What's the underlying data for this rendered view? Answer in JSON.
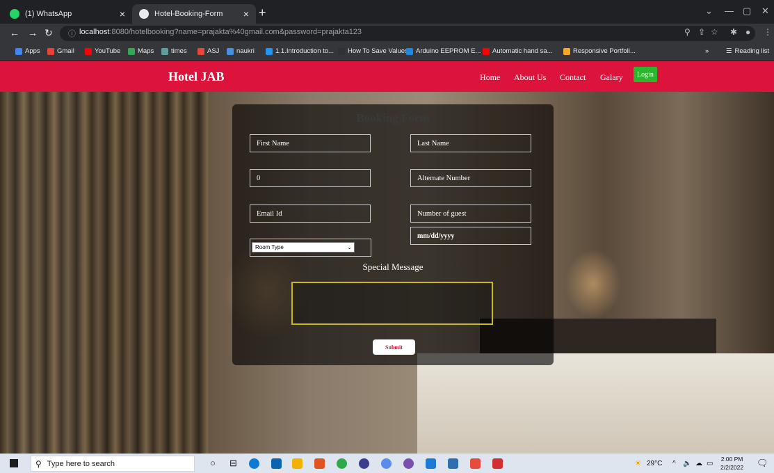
{
  "browser": {
    "tabs": [
      {
        "title": "(1) WhatsApp",
        "favicon_color": "#25d366"
      },
      {
        "title": "Hotel-Booking-Form",
        "favicon_color": "#e8eaed"
      }
    ],
    "new_tab_icon": "plus-icon",
    "url_host": "localhost",
    "url_rest": ":8080/hotelbooking?name=prajakta%40gmail.com&password=prajakta123",
    "bookmarks": [
      {
        "label": "Apps",
        "color": "#4285f4"
      },
      {
        "label": "Gmail",
        "color": "#ea4335"
      },
      {
        "label": "YouTube",
        "color": "#ff0000"
      },
      {
        "label": "Maps",
        "color": "#34a853"
      },
      {
        "label": "times",
        "color": "#5f9ea0"
      },
      {
        "label": "ASJ",
        "color": "#e8453c"
      },
      {
        "label": "naukri",
        "color": "#4a90e2"
      },
      {
        "label": "1.1.Introduction to...",
        "color": "#2196f3"
      },
      {
        "label": "How To Save Values...",
        "color": "#303134"
      },
      {
        "label": "Arduino EEPROM E...",
        "color": "#1e88e5"
      },
      {
        "label": "Automatic hand sa...",
        "color": "#ff0000"
      },
      {
        "label": "Responsive Portfoli...",
        "color": "#f9a825"
      }
    ],
    "reading_list": "Reading list"
  },
  "site": {
    "brand": "Hotel JAB",
    "nav": [
      "Home",
      "About Us",
      "Contact",
      "Galary"
    ],
    "login": "Login",
    "accent": "#dc143c",
    "login_color": "#2db52d"
  },
  "form": {
    "title": "Booking Form",
    "first_name": "First Name",
    "last_name": "Last Name",
    "phone": "0",
    "alternate_number": "Alternate Number",
    "email": "Email Id",
    "guests": "Number of guest",
    "date": "mm/dd/yyyy",
    "room_type": "Room Type",
    "special_message": "Special Message",
    "submit": "Submit"
  },
  "taskbar": {
    "search_placeholder": "Type here to search",
    "weather": "29°C",
    "time": "2:00 PM",
    "date": "2/2/2022"
  }
}
